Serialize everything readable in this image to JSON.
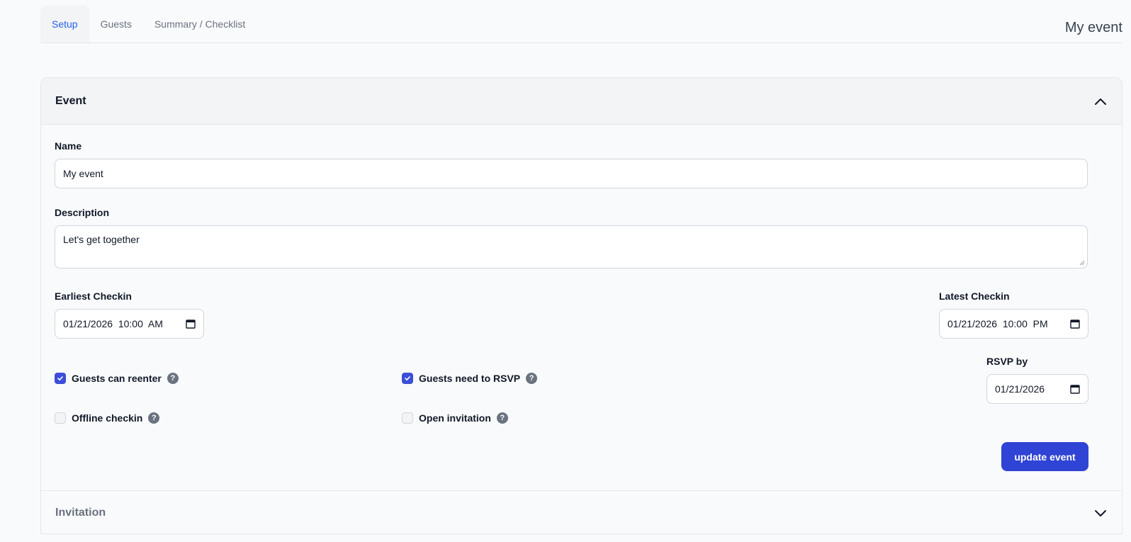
{
  "tabs": [
    {
      "label": "Setup"
    },
    {
      "label": "Guests"
    },
    {
      "label": "Summary / Checklist"
    }
  ],
  "event_title": "My event",
  "sections": {
    "event": {
      "title": "Event",
      "icon": "chevron-up-icon"
    },
    "invitation": {
      "title": "Invitation",
      "icon": "chevron-down-icon"
    }
  },
  "form": {
    "name_label": "Name",
    "name_value": "My event",
    "description_label": "Description",
    "description_value": "Let's get together",
    "earliest_label": "Earliest Checkin",
    "earliest_value": "01/21/2026  10:00  AM",
    "latest_label": "Latest Checkin",
    "latest_value": "01/21/2026  10:00  PM",
    "rsvp_label": "RSVP by",
    "rsvp_value": "01/21/2026",
    "options": [
      {
        "label": "Guests can reenter",
        "checked": true
      },
      {
        "label": "Guests need to RSVP",
        "checked": true
      },
      {
        "label": "Offline checkin",
        "checked": false
      },
      {
        "label": "Open invitation",
        "checked": false
      }
    ],
    "help_glyph": "?",
    "submit_label": "update event"
  },
  "colors": {
    "accent": "#2f44d4",
    "active_tab": "#2563eb",
    "checkbox_checked": "#3b4fd8"
  }
}
